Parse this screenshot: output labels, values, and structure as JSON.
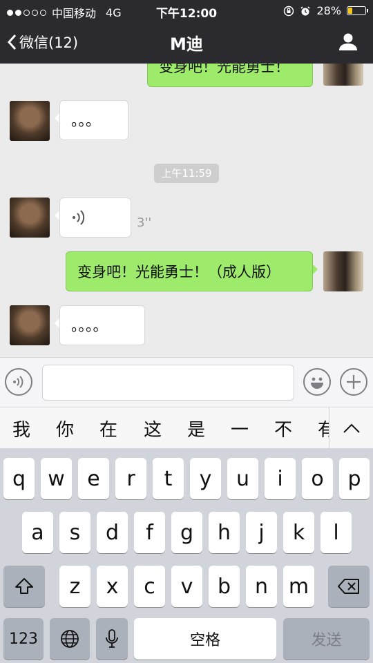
{
  "status_bar": {
    "carrier": "中国移动",
    "network": "4G",
    "time": "下午12:00",
    "battery": "28%",
    "battery_level": 0.28
  },
  "nav": {
    "back_label": "微信(12)",
    "title": "M迪"
  },
  "messages": {
    "m0": "变身吧！光能勇士！",
    "m1": "。。。",
    "timestamp": "上午11:59",
    "voice_duration": "3''",
    "m3": "变身吧！光能勇士！（成人版）",
    "m4": "。。。。"
  },
  "candidates": [
    "我",
    "你",
    "在",
    "这",
    "是",
    "一",
    "不",
    "有"
  ],
  "keyboard": {
    "row1": [
      "q",
      "w",
      "e",
      "r",
      "t",
      "y",
      "u",
      "i",
      "o",
      "p"
    ],
    "row2": [
      "a",
      "s",
      "d",
      "f",
      "g",
      "h",
      "j",
      "k",
      "l"
    ],
    "row3": [
      "z",
      "x",
      "c",
      "v",
      "b",
      "n",
      "m"
    ],
    "num_label": "123",
    "space_label": "空格",
    "send_label": "发送"
  },
  "colors": {
    "nav_bg": "#2b2b2f",
    "bubble_out": "#9eea6a",
    "bubble_in": "#ffffff",
    "battery": "#f5c518"
  }
}
